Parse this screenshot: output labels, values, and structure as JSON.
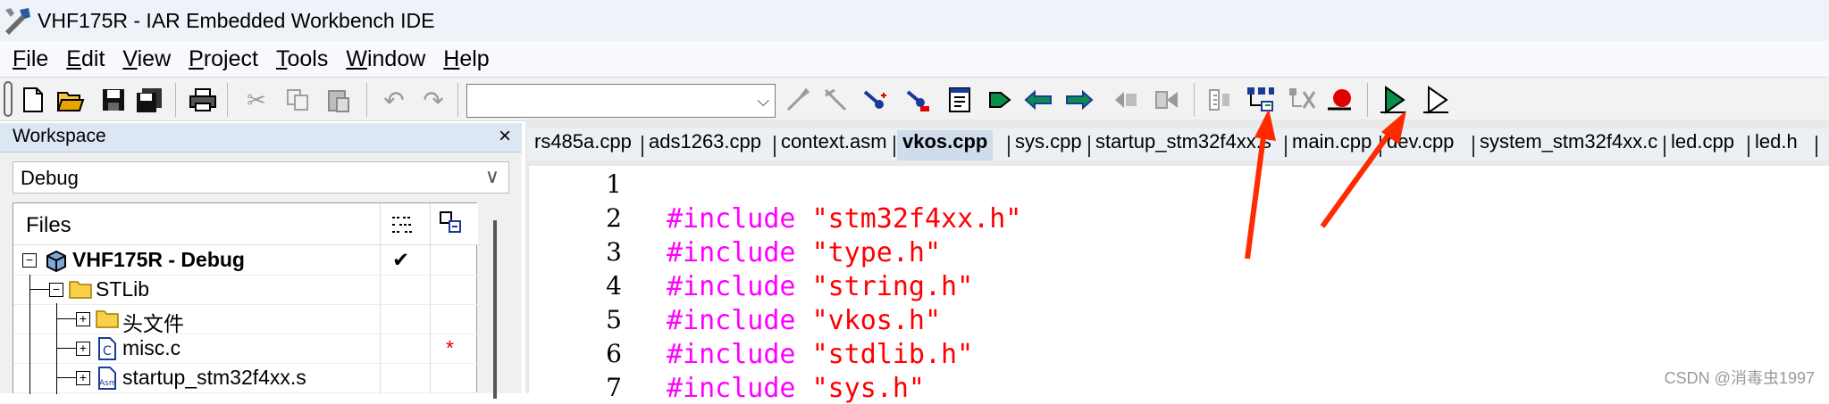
{
  "window": {
    "title": "VHF175R - IAR Embedded Workbench IDE"
  },
  "menu": {
    "items": [
      {
        "mnemonic": "F",
        "rest": "ile"
      },
      {
        "mnemonic": "E",
        "rest": "dit"
      },
      {
        "mnemonic": "V",
        "rest": "iew"
      },
      {
        "mnemonic": "P",
        "rest": "roject"
      },
      {
        "mnemonic": "T",
        "rest": "ools"
      },
      {
        "mnemonic": "W",
        "rest": "indow"
      },
      {
        "mnemonic": "H",
        "rest": "elp"
      }
    ]
  },
  "toolbar": {
    "find_combo_value": ""
  },
  "workspace": {
    "header": "Workspace",
    "close_glyph": "×",
    "config": "Debug",
    "files_header": "Files",
    "tree": [
      {
        "label": "VHF175R - Debug",
        "check": "✔",
        "star": ""
      },
      {
        "label": "STLib",
        "check": "",
        "star": ""
      },
      {
        "label": "头文件",
        "check": "",
        "star": ""
      },
      {
        "label": "misc.c",
        "check": "",
        "star": "*"
      },
      {
        "label": "startup_stm32f4xx.s",
        "check": "",
        "star": ""
      }
    ]
  },
  "editor": {
    "tabs": [
      "rs485a.cpp",
      "ads1263.cpp",
      "context.asm",
      "vkos.cpp",
      "sys.cpp",
      "startup_stm32f4xx.s",
      "main.cpp",
      "dev.cpp",
      "system_stm32f4xx.c",
      "led.cpp",
      "led.h"
    ],
    "active_tab": "vkos.cpp",
    "lines": [
      {
        "num": "1",
        "kw": "",
        "str": ""
      },
      {
        "num": "2",
        "kw": "#include",
        "str": "\"stm32f4xx.h\""
      },
      {
        "num": "3",
        "kw": "#include",
        "str": "\"type.h\""
      },
      {
        "num": "4",
        "kw": "#include",
        "str": "\"string.h\""
      },
      {
        "num": "5",
        "kw": "#include",
        "str": "\"vkos.h\""
      },
      {
        "num": "6",
        "kw": "#include",
        "str": "\"stdlib.h\""
      },
      {
        "num": "7",
        "kw": "#include",
        "str": "\"sys.h\""
      }
    ]
  },
  "watermark": "CSDN @消毒虫1997",
  "colors": {
    "keyword": "#ff00ff",
    "string": "#ff0000",
    "annotation_arrow": "#ff2a00"
  }
}
